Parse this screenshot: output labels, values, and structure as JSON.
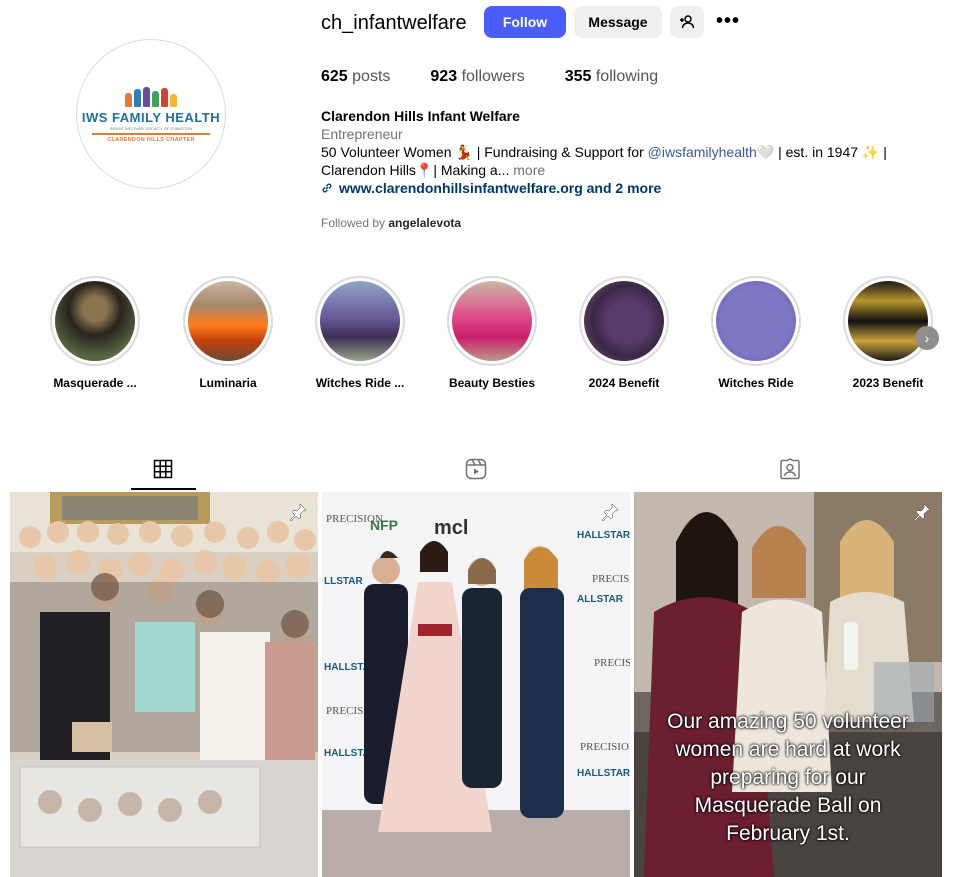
{
  "profile": {
    "username": "ch_infantwelfare",
    "follow_label": "Follow",
    "message_label": "Message",
    "logo": {
      "title": "IWS FAMILY HEALTH",
      "subtitle": "INFANT WELFARE SOCIETY OF EVANSTON",
      "chapter": "CLARENDON HILLS CHAPTER"
    },
    "stats": {
      "posts_count": "625",
      "posts_label": "posts",
      "followers_count": "923",
      "followers_label": "followers",
      "following_count": "355",
      "following_label": "following"
    },
    "bio": {
      "name": "Clarendon Hills Infant Welfare",
      "category": "Entrepreneur",
      "line1_a": "50 Volunteer Women 💃 | Fundraising & Support for ",
      "mention": "@iwsfamilyhealth",
      "line1_b": "🤍 | est. in 1947 ✨ |",
      "line2": "Clarendon Hills📍| Making a...",
      "more": " more",
      "website": "www.clarendonhillsinfantwelfare.org and 2 more"
    },
    "followed_by_prefix": "Followed by ",
    "followed_by_user": "angelalevota"
  },
  "highlights": [
    {
      "label": "Masquerade ..."
    },
    {
      "label": "Luminaria"
    },
    {
      "label": "Witches Ride ..."
    },
    {
      "label": "Beauty Besties"
    },
    {
      "label": "2024 Benefit"
    },
    {
      "label": "Witches Ride"
    },
    {
      "label": "2023 Benefit"
    }
  ],
  "posts": [
    {
      "overlay": ""
    },
    {
      "overlay": ""
    },
    {
      "overlay_lines": [
        "Our amazing 50 volunteer",
        "women are hard at work",
        "preparing for our",
        "Masquerade Ball on",
        "February 1st."
      ]
    }
  ],
  "colors": {
    "follow_button": "#4a5df9",
    "secondary_button": "#efefef",
    "link": "#00376b",
    "muted": "#737373"
  }
}
